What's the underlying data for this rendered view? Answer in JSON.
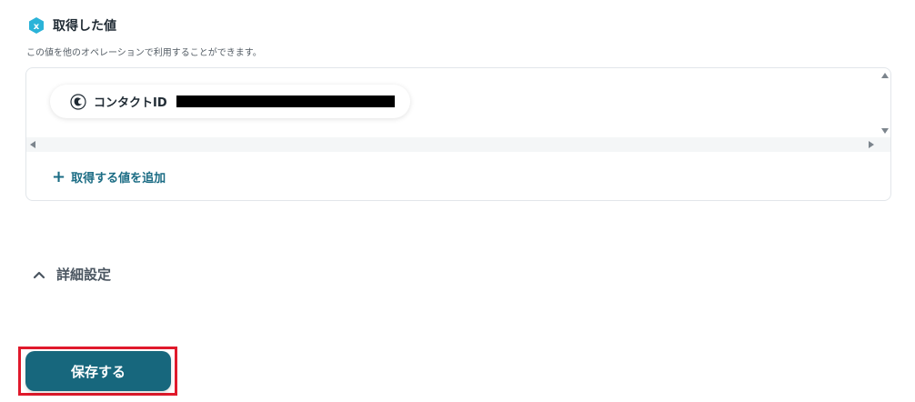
{
  "section": {
    "title": "取得した値",
    "description": "この値を他のオペレーションで利用することができます。",
    "icon": "hexagon-x-icon",
    "icon_color": "#2bb3d8"
  },
  "fields": [
    {
      "label": "コンタクトID",
      "icon": "mailchimp-icon",
      "value_redacted": true
    }
  ],
  "add_value": {
    "label": "取得する値を追加",
    "icon": "plus-icon"
  },
  "advanced_settings": {
    "label": "詳細設定",
    "icon": "chevron-up-icon"
  },
  "save_button": {
    "label": "保存する",
    "color": "#17677d",
    "highlight_color": "#e0192b"
  }
}
